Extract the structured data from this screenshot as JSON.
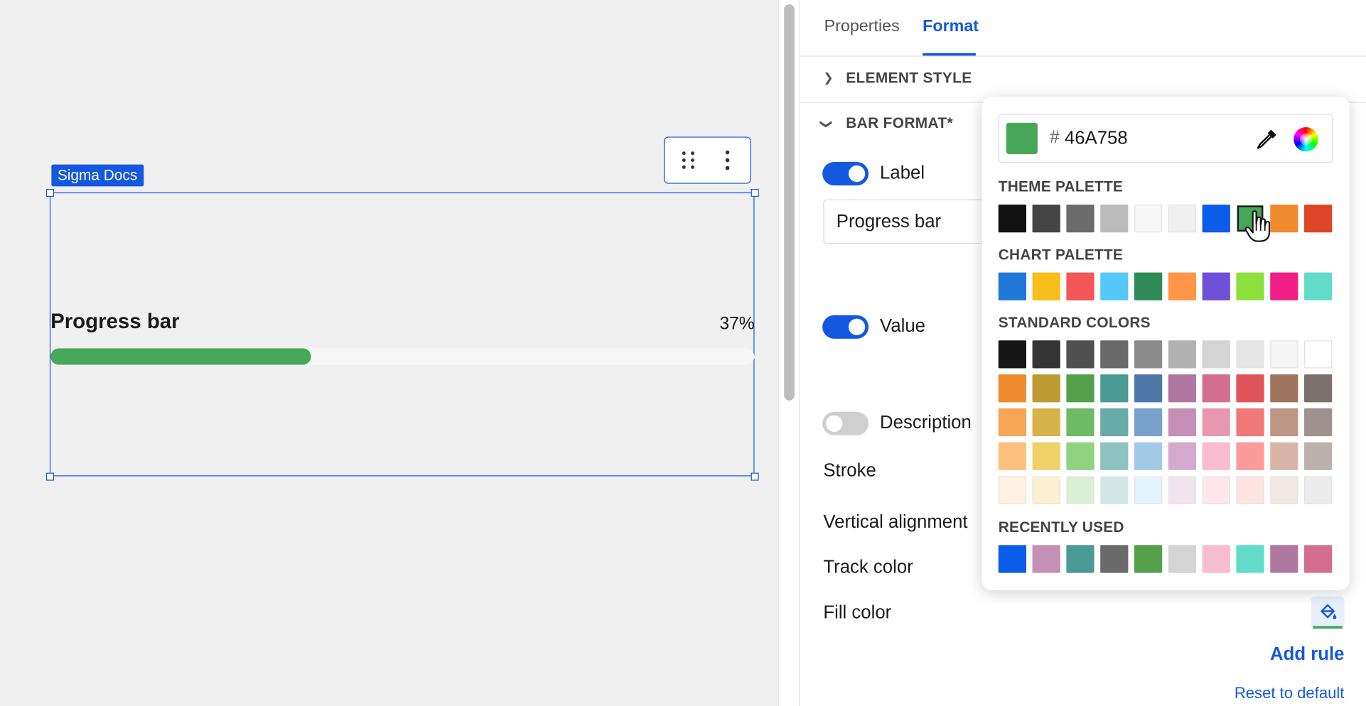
{
  "canvas": {
    "doc_tag": "Sigma Docs",
    "progress": {
      "label": "Progress bar",
      "value_text": "37%",
      "fraction": 0.37,
      "fill_color": "#46A758"
    }
  },
  "panel": {
    "tabs": [
      {
        "label": "Properties"
      },
      {
        "label": "Format"
      }
    ],
    "active_tab": "Format",
    "sections": {
      "element_style": "ELEMENT STYLE",
      "bar_format": "BAR FORMAT*"
    },
    "rows": {
      "label": {
        "text": "Label",
        "on": true
      },
      "label_input_value": "Progress bar",
      "value": {
        "text": "Value",
        "on": true
      },
      "description": {
        "text": "Description",
        "on": false
      },
      "stroke": "Stroke",
      "vertical_alignment": "Vertical alignment",
      "track_color": "Track color",
      "fill_color": "Fill color"
    },
    "add_rule": "Add rule",
    "reset": "Reset to default"
  },
  "picker": {
    "hex_prefix": "#",
    "hex_value": "46A758",
    "current_color": "#46A758",
    "icons": [
      "eyedropper-icon",
      "color-wheel-icon"
    ],
    "theme_title": "THEME PALETTE",
    "theme": [
      "#111111",
      "#444444",
      "#6b6b6b",
      "#bbbbbb",
      "#f6f6f6",
      "#f0f0f0",
      "#0b5ce8",
      "#46A758",
      "#f08a2f",
      "#dd4527"
    ],
    "selected_index": 7,
    "chart_title": "CHART PALETTE",
    "chart": [
      "#1f77d6",
      "#f6bf1c",
      "#f25656",
      "#55c8f7",
      "#2e8b57",
      "#ff9547",
      "#7050d6",
      "#8ddf3c",
      "#f11f86",
      "#62dcc8"
    ],
    "standard_title": "STANDARD COLORS",
    "standard": [
      [
        "#171717",
        "#343434",
        "#505050",
        "#6a6a6a",
        "#8a8a8a",
        "#b1b1b1",
        "#d4d4d4",
        "#e6e6e6",
        "#f5f5f5",
        "#ffffff"
      ],
      [
        "#f08a2f",
        "#bd9b32",
        "#55a04a",
        "#4a9a96",
        "#4e78a7",
        "#b078a0",
        "#d46e90",
        "#e0545c",
        "#a07560",
        "#7a706c"
      ],
      [
        "#f7a656",
        "#d5b34a",
        "#6fba65",
        "#68aca9",
        "#78a2cb",
        "#c58fb6",
        "#e897b0",
        "#f07878",
        "#bd9686",
        "#9f928e"
      ],
      [
        "#fcc07e",
        "#f0d068",
        "#90d182",
        "#8cc2c0",
        "#a2c9e6",
        "#d5a9cc",
        "#f7bcd0",
        "#fb9b9a",
        "#d8b5a6",
        "#bab0ac"
      ],
      [
        "#fff1e0",
        "#fbf0cf",
        "#dcf0d6",
        "#d2e6e5",
        "#e4f4fc",
        "#f0e3ee",
        "#fde6ec",
        "#fde3e2",
        "#f1e8e3",
        "#ececec"
      ]
    ],
    "recent_title": "RECENTLY USED",
    "recent": [
      "#0b5ce8",
      "#c58fb6",
      "#4a9a96",
      "#6a6a6a",
      "#55a04a",
      "#d4d4d4",
      "#f7bcd0",
      "#62dcc8",
      "#b078a0",
      "#d46e90"
    ]
  }
}
